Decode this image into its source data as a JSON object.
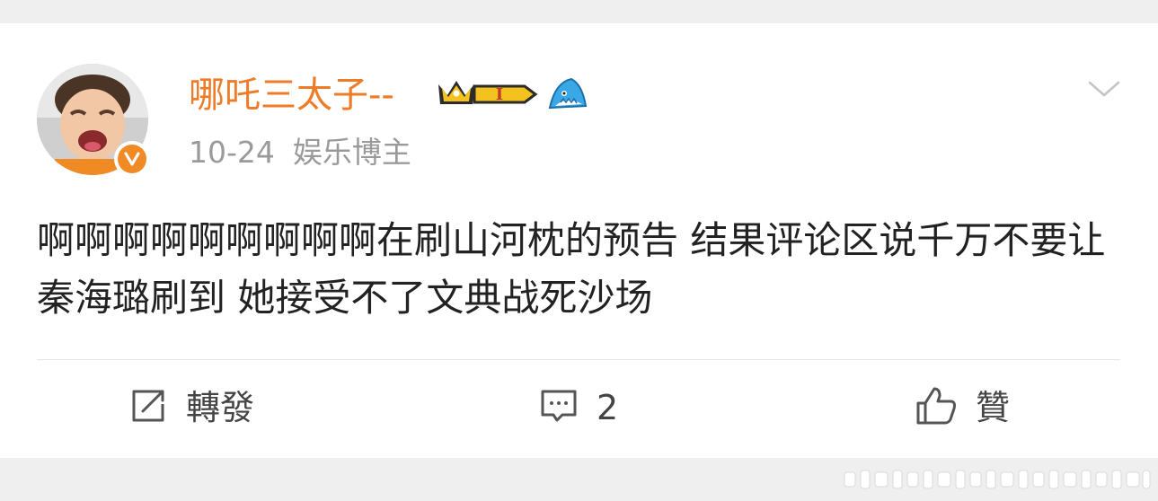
{
  "post": {
    "username": "哪吒三太子--",
    "timestamp": "10-24",
    "source": "娱乐博主",
    "text": "啊啊啊啊啊啊啊啊啊在刷山河枕的预告 结果评论区说千万不要让秦海璐刷到 她接受不了文典战死沙场"
  },
  "badges": {
    "level_text": "I"
  },
  "actions": {
    "repost_label": "轉發",
    "comment_count": "2",
    "like_label": "贊"
  },
  "colors": {
    "username": "#ee7b27",
    "verified": "#f08a24",
    "meta": "#9a9a9a",
    "text": "#222222"
  },
  "icons": {
    "avatar": "crying-child-avatar",
    "verified": "verified-v-icon",
    "crown_badge": "crown-badge-icon",
    "shark_badge": "shark-badge-icon",
    "more": "chevron-down-icon",
    "repost": "repost-icon",
    "comment": "comment-icon",
    "like": "thumbs-up-icon"
  }
}
